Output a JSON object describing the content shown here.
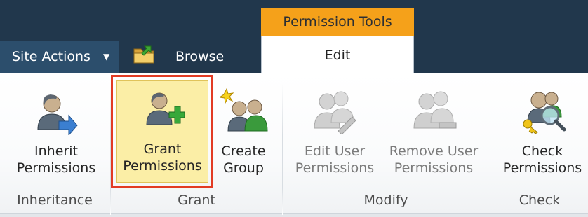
{
  "header": {
    "contextual_tab": "Permission Tools",
    "site_actions": "Site Actions",
    "tabs": [
      {
        "label": "Browse"
      },
      {
        "label": "Edit"
      }
    ]
  },
  "ribbon": {
    "buttons": {
      "inherit": {
        "line1": "Inherit",
        "line2": "Permissions"
      },
      "grant": {
        "line1": "Grant",
        "line2": "Permissions"
      },
      "create_group": {
        "line1": "Create",
        "line2": "Group"
      },
      "edit_user": {
        "line1": "Edit User",
        "line2": "Permissions"
      },
      "remove_user": {
        "line1": "Remove User",
        "line2": "Permissions"
      },
      "check": {
        "line1": "Check",
        "line2": "Permissions"
      }
    },
    "groups": [
      "Inheritance",
      "Grant",
      "Modify",
      "Check"
    ]
  },
  "colors": {
    "header_bg": "#21374c",
    "contextual_tab": "#f5a11a",
    "selected_button": "#fbeea6",
    "highlight_border": "#e23b24"
  },
  "icons": [
    "folder-up-icon",
    "user-arrow-icon",
    "user-add-icon",
    "group-add-icon",
    "user-edit-icon",
    "user-remove-icon",
    "user-check-icon"
  ]
}
